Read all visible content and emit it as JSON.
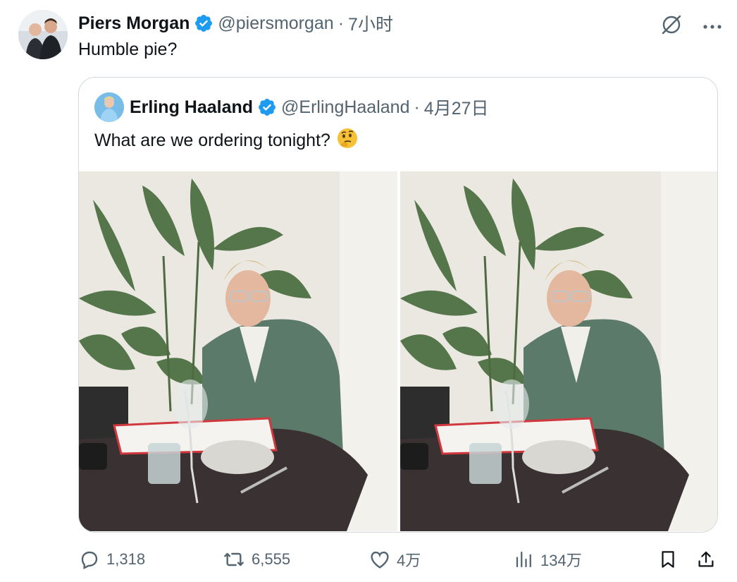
{
  "tweet": {
    "author_name": "Piers Morgan",
    "handle": "@piersmorgan",
    "separator": "·",
    "time": "7小时",
    "text": "Humble pie?"
  },
  "quoted": {
    "author_name": "Erling Haaland",
    "handle": "@ErlingHaaland",
    "separator": "·",
    "date": "4月27日",
    "text": "What are we ordering tonight?",
    "emoji": "🤔"
  },
  "actions": {
    "replies": "1,318",
    "reposts": "6,555",
    "likes": "4万",
    "views": "134万"
  },
  "colors": {
    "verified": "#1d9bf0",
    "text": "#0f1419",
    "muted": "#536471",
    "border": "#cfd9de"
  },
  "icons": [
    "verified-badge-icon",
    "grok-icon",
    "more-icon",
    "reply-icon",
    "repost-icon",
    "like-icon",
    "views-icon",
    "bookmark-icon",
    "share-icon"
  ]
}
